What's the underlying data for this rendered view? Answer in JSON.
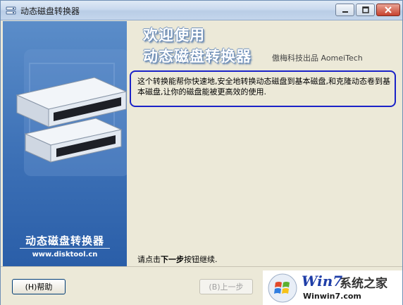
{
  "window": {
    "title": "动态磁盘转换器"
  },
  "banner": {
    "title": "动态磁盘转换器",
    "url": "www.disktool.cn"
  },
  "content": {
    "heading_line1": "欢迎使用",
    "heading_line2": "动态磁盘转换器",
    "vendor": "傲梅科技出品 AomeiTech",
    "description": "这个转换能帮你快速地,安全地转换动态磁盘到基本磁盘,和克隆动态卷到基本磁盘,让你的磁盘能被更高效的使用.",
    "hint_prefix": "请点击",
    "hint_bold": "下一步",
    "hint_suffix": "按钮继续."
  },
  "footer": {
    "help_label": "(H)帮助",
    "prev_label": "(B)上一步"
  },
  "watermark": {
    "brand": "Win7",
    "brand_cn": "系统之家",
    "url": "Winwin7.com"
  },
  "colors": {
    "accent_blue": "#1a22c8",
    "banner_blue": "#3f73b8"
  }
}
